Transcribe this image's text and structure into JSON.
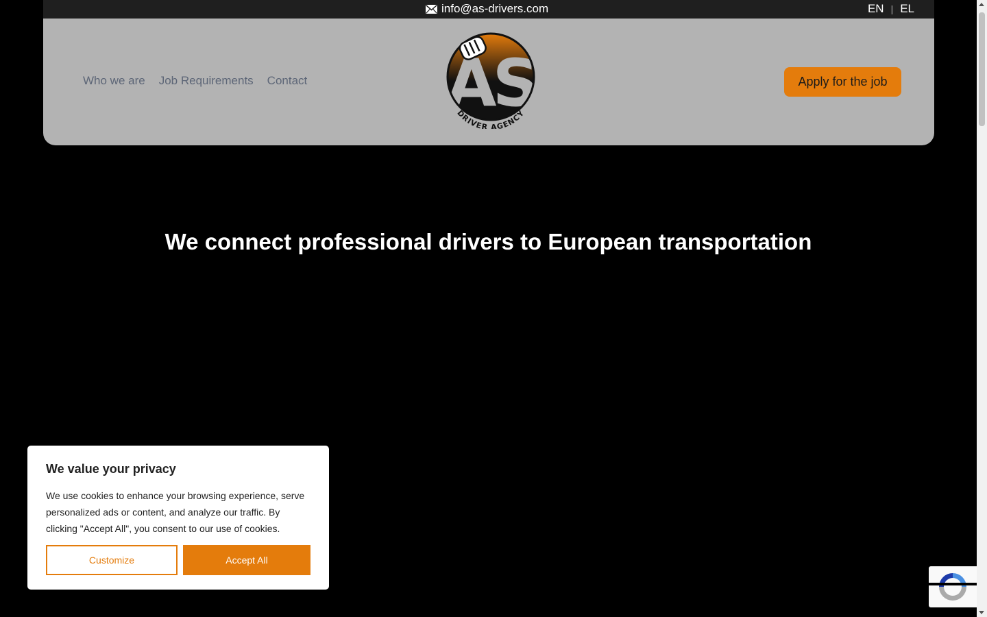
{
  "topbar": {
    "email": "info@as-drivers.com",
    "languages": [
      "EN",
      "EL"
    ],
    "language_separator": "|"
  },
  "header": {
    "nav": [
      "Who we are",
      "Job Requirements",
      "Contact"
    ],
    "logo_alt": "AS Driver Agency",
    "logo_letters": "AS",
    "logo_subtext": "DRIVER AGENCY",
    "apply_label": "Apply for the job"
  },
  "hero": {
    "title": "We connect professional drivers to European transportation"
  },
  "cookie": {
    "title": "We value your privacy",
    "body": "We use cookies to enhance your browsing experience, serve personalized ads or content, and analyze our traffic. By clicking \"Accept All\", you consent to our use of cookies.",
    "customize_label": "Customize",
    "accept_label": "Accept All"
  },
  "colors": {
    "accent": "#e47c0c",
    "header_bg": "#b3b3b3",
    "topbar_bg": "#1f1f1f",
    "nav_text": "#5d6677"
  },
  "icons": [
    "envelope-icon",
    "fist-icon",
    "recaptcha-icon"
  ]
}
